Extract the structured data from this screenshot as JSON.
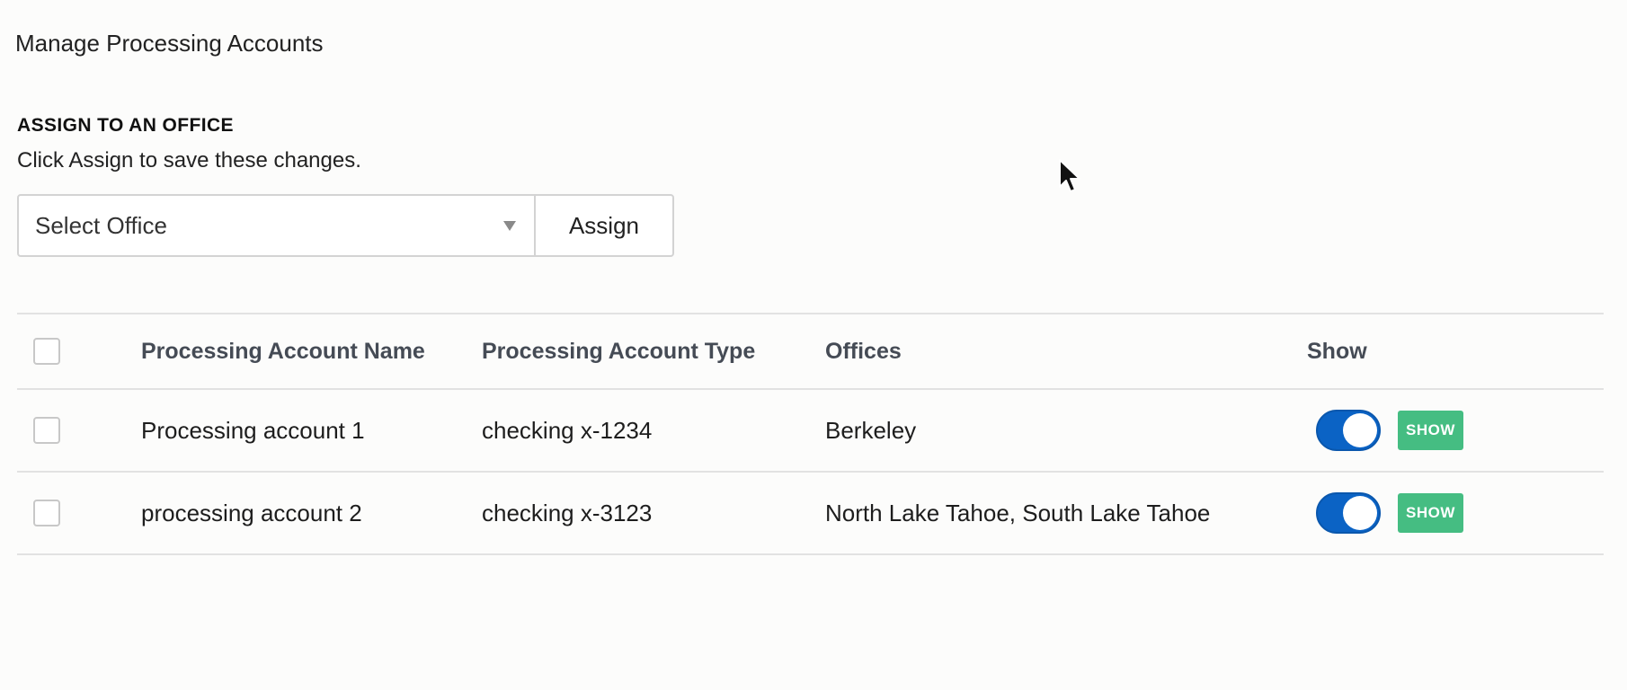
{
  "page": {
    "title": "Manage Processing Accounts"
  },
  "assign_section": {
    "heading": "ASSIGN TO AN OFFICE",
    "help_text": "Click Assign to save these changes.",
    "select": {
      "value": "Select Office"
    },
    "assign_label": "Assign"
  },
  "table": {
    "columns": {
      "name": "Processing Account Name",
      "type": "Processing Account Type",
      "offices": "Offices",
      "show": "Show"
    },
    "rows": [
      {
        "name": "Processing account 1",
        "type": "checking x-1234",
        "offices": "Berkeley",
        "toggle_on": true,
        "show_label": "SHOW"
      },
      {
        "name": "processing account 2",
        "type": "checking x-3123",
        "offices": "North Lake Tahoe, South Lake Tahoe",
        "toggle_on": true,
        "show_label": "SHOW"
      }
    ]
  },
  "colors": {
    "toggle_on": "#0b63c5",
    "show_badge": "#45bd82",
    "header_text": "#454b55"
  },
  "icons": {
    "dropdown": "caret-down-icon",
    "pointer": "mouse-pointer-icon"
  }
}
